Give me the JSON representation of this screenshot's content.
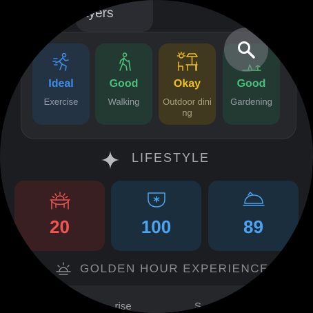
{
  "header": {
    "partial_label": "ayers"
  },
  "search": {
    "icon": "search-icon"
  },
  "activities": [
    {
      "rating": "Ideal",
      "name": "Exercise",
      "icon": "running-person-icon",
      "color": "#3e8de8"
    },
    {
      "rating": "Good",
      "name": "Walking",
      "icon": "walking-person-icon",
      "color": "#4cc07a"
    },
    {
      "rating": "Okay",
      "name": "Outdoor dining",
      "icon": "outdoor-dining-icon",
      "color": "#f0c020"
    },
    {
      "rating": "Good",
      "name": "Gardening",
      "icon": "gardening-icon",
      "color": "#4cc07a"
    }
  ],
  "lifestyle": {
    "title": "LIFESTYLE",
    "icon": "sparkle-icon"
  },
  "metrics": [
    {
      "value": "20",
      "icon": "uv-index-icon",
      "color": "#f0554f"
    },
    {
      "value": "100",
      "icon": "air-quality-icon",
      "color": "#4da3ef"
    },
    {
      "value": "89",
      "icon": "pollen-icon",
      "color": "#4da3ef"
    }
  ],
  "golden_hour": {
    "title": "GOLDEN HOUR EXPERIENCE",
    "icon": "sunset-icon"
  },
  "bottom": {
    "label1": "...rise",
    "label2": "S..."
  }
}
